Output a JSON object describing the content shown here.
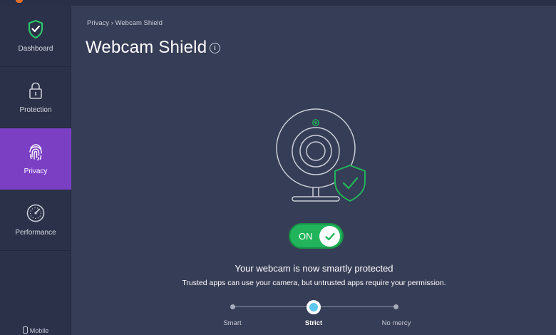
{
  "sidebar": {
    "items": [
      {
        "label": "Dashboard",
        "icon": "shield-check-icon",
        "active": false
      },
      {
        "label": "Protection",
        "icon": "lock-icon",
        "active": false
      },
      {
        "label": "Privacy",
        "icon": "fingerprint-icon",
        "active": true
      },
      {
        "label": "Performance",
        "icon": "speedometer-icon",
        "active": false
      }
    ],
    "mobile_label": "Mobile"
  },
  "header": {
    "breadcrumb": "Privacy › Webcam Shield",
    "title": "Webcam Shield",
    "info_icon": "i"
  },
  "toggle": {
    "label": "ON",
    "state": true
  },
  "status": {
    "title": "Your webcam is now smartly protected",
    "subtitle": "Trusted apps can use your camera, but untrusted apps require your permission."
  },
  "mode": {
    "options": [
      "Smart",
      "Strict",
      "No mercy"
    ],
    "selected": "Strict"
  },
  "colors": {
    "background": "#363d56",
    "sidebar": "#2b3148",
    "active": "#7b3fc4",
    "accent_green": "#21b45a",
    "slider_thumb": "#5ec7ee"
  }
}
